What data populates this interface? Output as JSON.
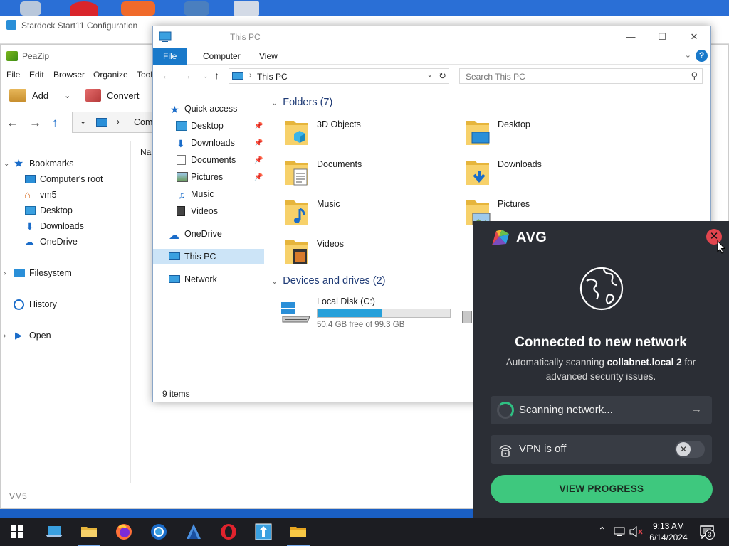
{
  "stardock": {
    "title": "Stardock Start11 Configuration"
  },
  "peazip": {
    "title": "PeaZip",
    "menu": [
      "File",
      "Edit",
      "Browser",
      "Organize",
      "Tool"
    ],
    "toolbar": {
      "add": "Add",
      "convert": "Convert"
    },
    "path_text": "Comp",
    "column_header": "Nar",
    "tree": {
      "bookmarks": "Bookmarks",
      "computers_root": "Computer's root",
      "vm5": "vm5",
      "desktop": "Desktop",
      "downloads": "Downloads",
      "onedrive": "OneDrive",
      "filesystem": "Filesystem",
      "history": "History",
      "open": "Open"
    },
    "status": "VM5"
  },
  "explorer": {
    "title": "This PC",
    "ribbon": {
      "file": "File",
      "computer": "Computer",
      "view": "View",
      "help": "?"
    },
    "address": "This PC",
    "search_placeholder": "Search This PC",
    "nav": {
      "quick_access": "Quick access",
      "desktop": "Desktop",
      "downloads": "Downloads",
      "documents": "Documents",
      "pictures": "Pictures",
      "music": "Music",
      "videos": "Videos",
      "onedrive": "OneDrive",
      "this_pc": "This PC",
      "network": "Network"
    },
    "folders_header": "Folders (7)",
    "folders": {
      "objects3d": "3D Objects",
      "desktop": "Desktop",
      "documents": "Documents",
      "downloads": "Downloads",
      "music": "Music",
      "pictures": "Pictures",
      "videos": "Videos"
    },
    "devices_header": "Devices and drives (2)",
    "drive": {
      "name": "Local Disk (C:)",
      "free": "50.4 GB free of 99.3 GB",
      "used_fraction": 0.49
    },
    "status": "9 items"
  },
  "avg": {
    "brand": "AVG",
    "heading": "Connected to new network",
    "desc_pre": "Automatically scanning ",
    "desc_network": "collabnet.local 2",
    "desc_post": " for advanced security issues.",
    "scanning": "Scanning network...",
    "vpn": "VPN is off",
    "cta": "VIEW PROGRESS"
  },
  "taskbar": {
    "time": "9:13 AM",
    "date": "6/14/2024",
    "notification_count": "3"
  },
  "colors": {
    "accent": "#1979ca",
    "avg_bg": "#2b2e35",
    "avg_green": "#3ec87e",
    "avg_close": "#e2454e"
  }
}
